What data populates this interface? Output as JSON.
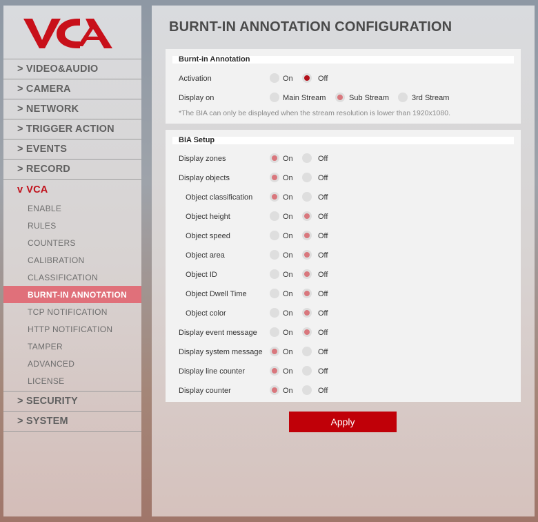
{
  "brand": {
    "logo_text": "VCA",
    "accent": "#c8101a",
    "active_bg": "#e0707a"
  },
  "sidebar": {
    "items": [
      {
        "label": "> VIDEO&AUDIO"
      },
      {
        "label": "> CAMERA"
      },
      {
        "label": "> NETWORK"
      },
      {
        "label": "> TRIGGER ACTION"
      },
      {
        "label": "> EVENTS"
      },
      {
        "label": "> RECORD"
      },
      {
        "label": "VCA",
        "caret": "v"
      },
      {
        "label": "> SECURITY"
      },
      {
        "label": "> SYSTEM"
      }
    ],
    "vca_sub": [
      "ENABLE",
      "RULES",
      "COUNTERS",
      "CALIBRATION",
      "CLASSIFICATION",
      "BURNT-IN ANNOTATION",
      "TCP NOTIFICATION",
      "HTTP NOTIFICATION",
      "TAMPER",
      "ADVANCED",
      "LICENSE"
    ]
  },
  "page": {
    "title": "BURNT-IN ANNOTATION CONFIGURATION"
  },
  "bia": {
    "header": "Burnt-in Annotation",
    "activation": {
      "label": "Activation",
      "on": "On",
      "off": "Off",
      "selected": "off"
    },
    "display_on": {
      "label": "Display on",
      "options": [
        "Main Stream",
        "Sub Stream",
        "3rd Stream"
      ],
      "selected": "Sub Stream"
    },
    "note": "*The BIA can only be displayed when the stream resolution is lower than 1920x1080."
  },
  "setup": {
    "header": "BIA Setup",
    "on_label": "On",
    "off_label": "Off",
    "rows": [
      {
        "label": "Display zones",
        "value": "on",
        "indent": false
      },
      {
        "label": "Display objects",
        "value": "on",
        "indent": false
      },
      {
        "label": "Object classification",
        "value": "on",
        "indent": true
      },
      {
        "label": "Object height",
        "value": "off",
        "indent": true
      },
      {
        "label": "Object speed",
        "value": "off",
        "indent": true
      },
      {
        "label": "Object area",
        "value": "off",
        "indent": true
      },
      {
        "label": "Object ID",
        "value": "off",
        "indent": true
      },
      {
        "label": "Object Dwell Time",
        "value": "off",
        "indent": true
      },
      {
        "label": "Object color",
        "value": "off",
        "indent": true
      },
      {
        "label": "Display event message",
        "value": "off",
        "indent": false
      },
      {
        "label": "Display system message",
        "value": "on",
        "indent": false
      },
      {
        "label": "Display line counter",
        "value": "on",
        "indent": false
      },
      {
        "label": "Display counter",
        "value": "on",
        "indent": false
      }
    ]
  },
  "apply_label": "Apply"
}
